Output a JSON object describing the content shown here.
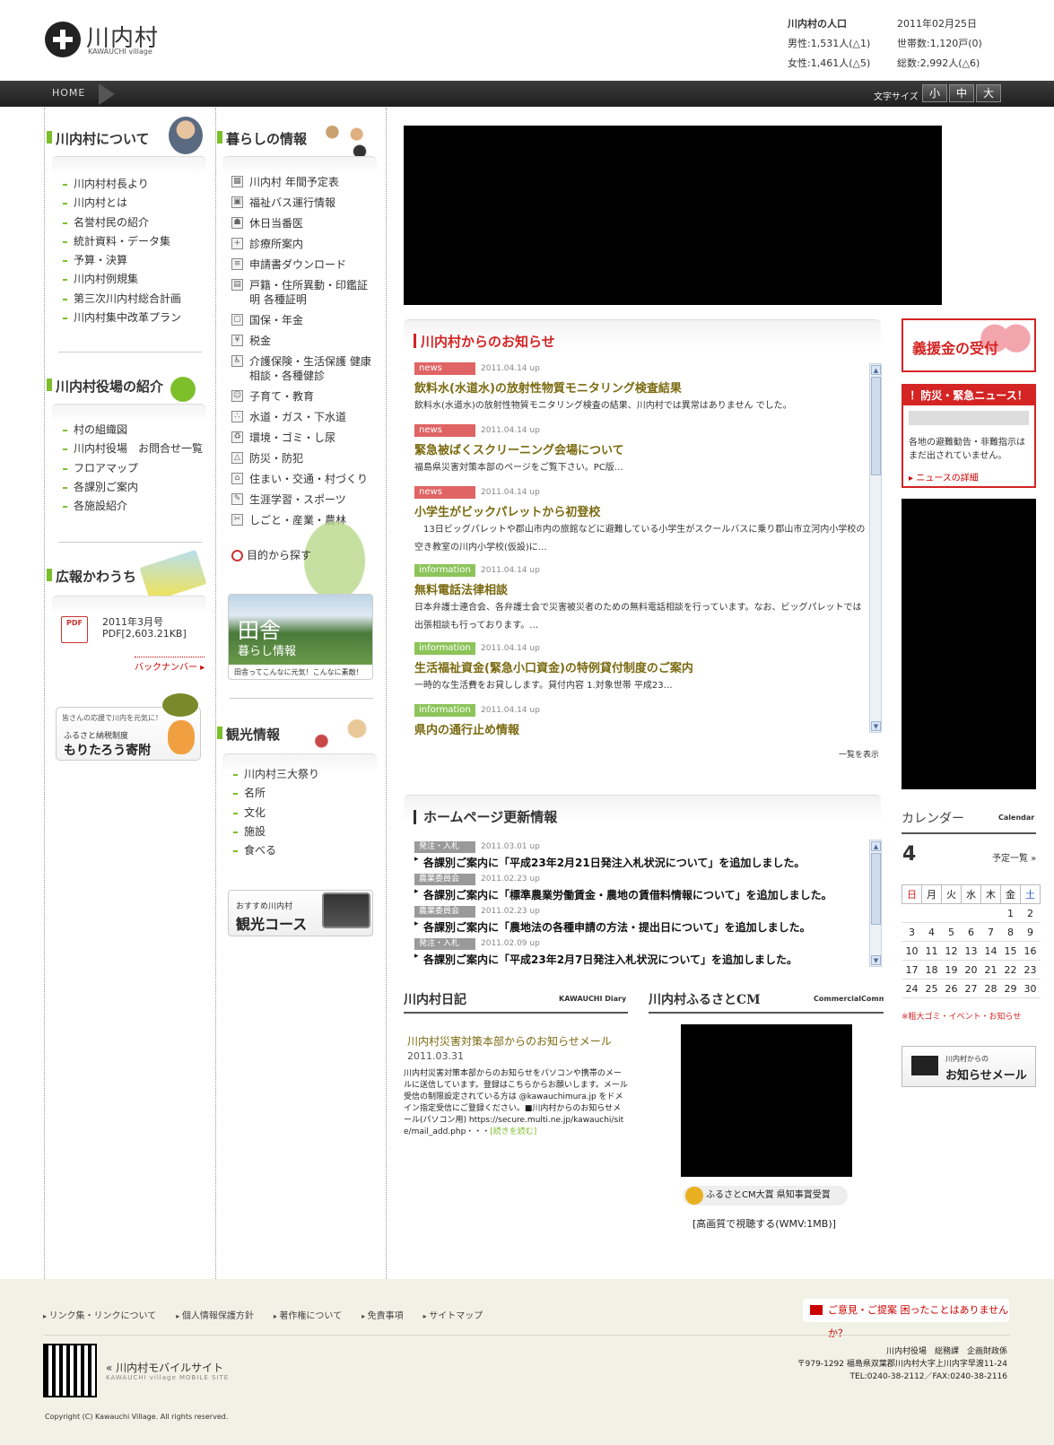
{
  "header": {
    "logo_name": "川内村",
    "logo_sub": "KAWAUCHI village",
    "population": {
      "title": "川内村の人口",
      "date": "2011年02月25日",
      "male": "男性:1,531人(△1)",
      "households": "世帯数:1,120戸(0)",
      "female": "女性:1,461人(△5)",
      "total": "総数:2,992人(△6)"
    }
  },
  "nav": {
    "home": "HOME",
    "font_size_label": "文字サイズ",
    "font_sizes": [
      "小",
      "中",
      "大"
    ]
  },
  "col1": {
    "about_title": "川内村について",
    "about_items": [
      "川内村村長より",
      "川内村とは",
      "名誉村民の紹介",
      "統計資料・データ集",
      "予算・決算",
      "川内村例規集",
      "第三次川内村総合計画",
      "川内村集中改革プラン"
    ],
    "office_title": "川内村役場の紹介",
    "office_items": [
      "村の組織図",
      "川内村役場　お問合せ一覧",
      "フロアマップ",
      "各課別ご案内",
      "各施設紹介"
    ],
    "pr_title": "広報かわうち",
    "pr_issue": "2011年3月号",
    "pr_file": "PDF[2,603.21KB]",
    "pdf_icon": "PDF",
    "backnumber": "バックナンバー",
    "furusato_small": "皆さんの応援で川内を元気に！",
    "furusato_mid": "ふるさと納税制度",
    "furusato_big": "もりたろう寄附"
  },
  "col2": {
    "life_title": "暮らしの情報",
    "life_items": [
      {
        "label": "川内村 年間予定表",
        "icon": "calendar-icon"
      },
      {
        "label": "福祉バス運行情報",
        "icon": "bus-icon"
      },
      {
        "label": "休日当番医",
        "icon": "doctor-icon"
      },
      {
        "label": "診療所案内",
        "icon": "clinic-icon"
      },
      {
        "label": "申請書ダウンロード",
        "icon": "document-icon"
      },
      {
        "label": "戸籍・住所異動・印鑑証明 各種証明",
        "icon": "certificate-icon"
      },
      {
        "label": "国保・年金",
        "icon": "pension-icon"
      },
      {
        "label": "税金",
        "icon": "tax-icon"
      },
      {
        "label": "介護保険・生活保護 健康相談・各種健診",
        "icon": "care-icon"
      },
      {
        "label": "子育て・教育",
        "icon": "child-icon"
      },
      {
        "label": "水道・ガス・下水道",
        "icon": "water-icon"
      },
      {
        "label": "環境・ゴミ・し尿",
        "icon": "recycle-icon"
      },
      {
        "label": "防災・防犯",
        "icon": "safety-icon"
      },
      {
        "label": "住まい・交通・村づくり",
        "icon": "house-icon"
      },
      {
        "label": "生涯学習・スポーツ",
        "icon": "sports-icon"
      },
      {
        "label": "しごと・産業・農林",
        "icon": "work-icon"
      }
    ],
    "purpose_search": "目的から探す",
    "inaka_big": "田舎",
    "inaka_sub": "暮らし情報",
    "inaka_caption": "田舎ってこんなに元気！こんなに素敵！",
    "tour_title": "観光情報",
    "tour_items": [
      "川内村三大祭り",
      "名所",
      "文化",
      "施設",
      "食べる"
    ],
    "course_small": "おすすめ川内村",
    "course_big": "観光コース"
  },
  "news": {
    "title": "川内村からのお知らせ",
    "more": "一覧を表示",
    "items": [
      {
        "badge": "news",
        "date": "2011.04.14 up",
        "title": "飲料水(水道水)の放射性物質モニタリング検査結果",
        "body": "飲料水(水道水)の放射性物質モニタリング検査の結果、川内村では異常はありません でした。"
      },
      {
        "badge": "news",
        "date": "2011.04.14 up",
        "title": "緊急被ばくスクリーニング会場について",
        "body": "福島県災害対策本部のページをご覧下さい。PC版…"
      },
      {
        "badge": "news",
        "date": "2011.04.14 up",
        "title": "小学生がビックパレットから初登校",
        "body": "　13日ビッグパレットや郡山市内の旅館などに避難している小学生がスクールバスに乗り郡山市立河内小学校の空き教室の川内小学校(仮設)に…"
      },
      {
        "badge": "information",
        "date": "2011.04.14 up",
        "title": "無料電話法律相談",
        "body": "日本弁護士連合会、各弁護士会で災害被災者のための無料電話相談を行っています。なお、ビッグパレットでは出張相談も行っております。…"
      },
      {
        "badge": "information",
        "date": "2011.04.14 up",
        "title": "生活福祉資金(緊急小口資金)の特例貸付制度のご案内",
        "body": "一時的な生活費をお貸しします。貸付内容 1.対象世帯 平成23…"
      },
      {
        "badge": "information",
        "date": "2011.04.14 up",
        "title": "県内の通行止め情報",
        "body": ""
      }
    ]
  },
  "updates": {
    "title": "ホームページ更新情報",
    "items": [
      {
        "badge": "発注・入札",
        "date": "2011.03.01 up",
        "text": "各課別ご案内に「平成23年2月21日発注入札状況について」を追加しました。"
      },
      {
        "badge": "農業委員会",
        "date": "2011.02.23 up",
        "text": "各課別ご案内に「標準農業労働賃金・農地の賃借料情報について」を追加しました。"
      },
      {
        "badge": "農業委員会",
        "date": "2011.02.23 up",
        "text": "各課別ご案内に「農地法の各種申請の方法・提出日について」を追加しました。"
      },
      {
        "badge": "発注・入札",
        "date": "2011.02.09 up",
        "text": "各課別ご案内に「平成23年2月7日発注入札状況について」を追加しました。"
      }
    ]
  },
  "diary": {
    "title": "川内村日記",
    "title_en": "KAWAUCHI Diary",
    "post_title": "川内村災害対策本部からのお知らせメール",
    "post_date": "2011.03.31",
    "post_body": "川内村災害対策本部からのお知らせをパソコンや携帯のメールに送信しています。登録はこちらからお願いします。メール受信の制限設定されている方は @kawauchimura.jp をドメイン指定受信にご登録ください。■川内村からのお知らせメール(パソコン用) https://secure.multi.ne.jp/kawauchi/site/mail_add.php・・・",
    "read_more": "[続きを読む]"
  },
  "cm": {
    "title": "川内村ふるさとCM",
    "title_en": "CommercialComm",
    "award": "ふるさとCM大賞 県知事賞受賞",
    "hq_link": "[高画質で視聴する(WMV:1MB)]"
  },
  "right": {
    "donation": "義援金の受付",
    "disaster_title": "！防災・緊急ニュース！",
    "disaster_body": "各地の避難勧告・非難指示はまだ出されていません。",
    "disaster_link": "ニュースの詳細",
    "calendar_title": "カレンダー",
    "calendar_en": "Calendar",
    "month": "4",
    "schedule_link": "予定一覧 »",
    "weekdays": [
      "日",
      "月",
      "火",
      "水",
      "木",
      "金",
      "土"
    ],
    "weeks": [
      [
        "",
        "",
        "",
        "",
        "",
        "1",
        "2"
      ],
      [
        "3",
        "4",
        "5",
        "6",
        "7",
        "8",
        "9"
      ],
      [
        "10",
        "11",
        "12",
        "13",
        "14",
        "15",
        "16"
      ],
      [
        "17",
        "18",
        "19",
        "20",
        "21",
        "22",
        "23"
      ],
      [
        "24",
        "25",
        "26",
        "27",
        "28",
        "29",
        "30"
      ]
    ],
    "calendar_note": "※粗大ゴミ・イベント・お知らせ",
    "mail_small": "川内村からの",
    "mail_big": "お知らせメール"
  },
  "footer": {
    "links": [
      "リンク集・リンクについて",
      "個人情報保護方針",
      "著作権について",
      "免責事項",
      "サイトマップ"
    ],
    "opinion": "ご意見・ご提案 困ったことはありませんか？",
    "mobile": "« 川内村モバイルサイト",
    "mobile_en": "KAWAUCHI village MOBILE SITE",
    "office": "川内村役場　総務課　企画財政係",
    "address": "〒979-1292 福島県双葉郡川内村大字上川内字早渡11-24",
    "tel": "TEL:0240-38-2112／FAX:0240-38-2116",
    "copyright": "Copyright (C) Kawauchi Village. All rights reserved."
  },
  "colors": {
    "accent_green": "#7cbf2b",
    "accent_red": "#d42424",
    "news_title": "#7a6a10",
    "footer_bg": "#f2f1e6"
  }
}
